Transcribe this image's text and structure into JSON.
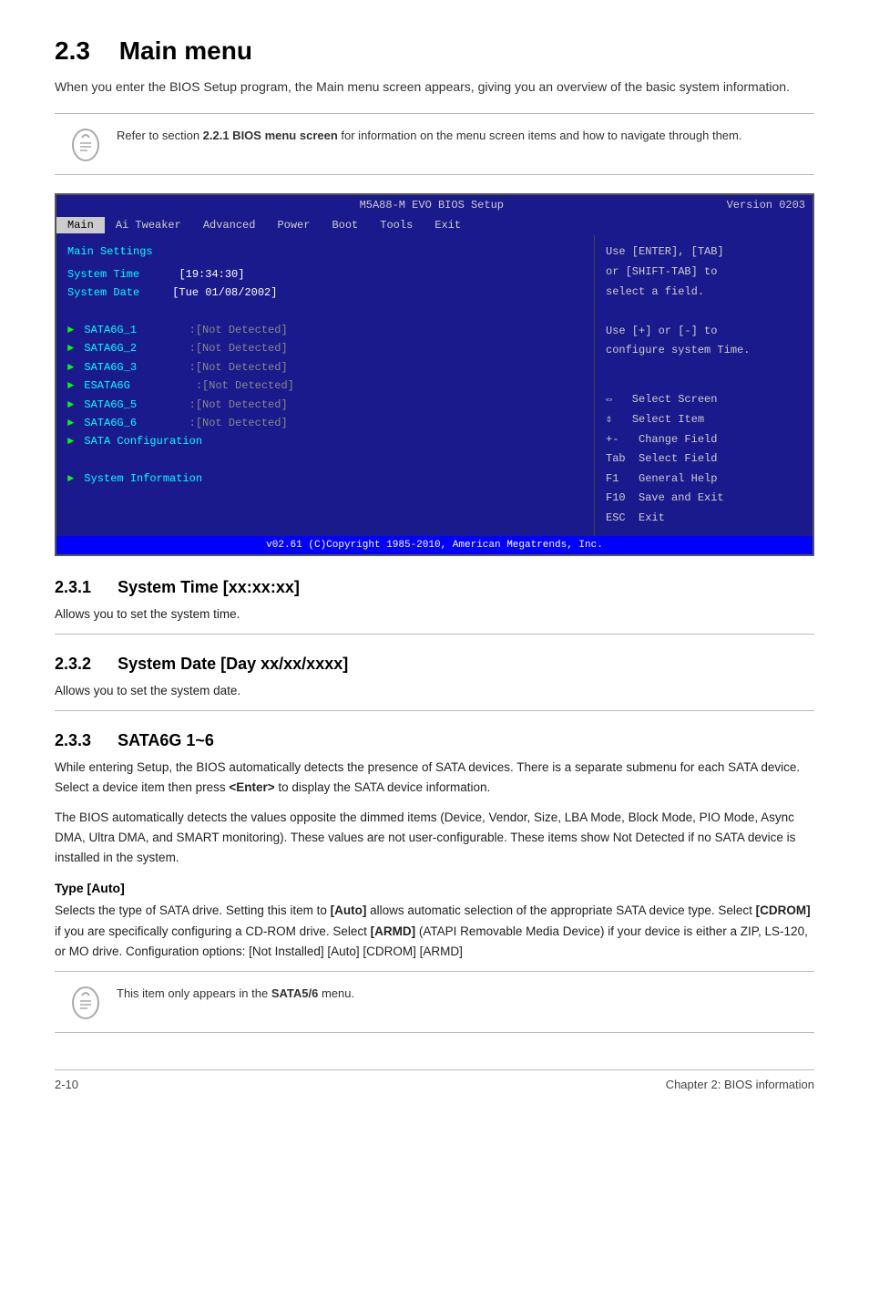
{
  "page": {
    "section_number": "2.3",
    "section_title": "Main menu",
    "intro": "When you enter the BIOS Setup program, the Main menu screen appears, giving you an overview of the basic system information.",
    "note1": {
      "text": "Refer to section ",
      "bold": "2.2.1 BIOS menu screen",
      "text2": " for information on the menu screen items and how to navigate through them."
    },
    "bios": {
      "title_center": "M5A88-M EVO BIOS Setup",
      "title_right": "Version 0203",
      "menu_items": [
        "Main",
        "Ai Tweaker",
        "Advanced",
        "Power",
        "Boot",
        "Tools",
        "Exit"
      ],
      "active_menu": "Main",
      "section_header": "Main Settings",
      "system_time_label": "System Time",
      "system_time_value": "[19:34:30]",
      "system_date_label": "System Date",
      "system_date_value": "[Tue 01/08/2002]",
      "sata_items": [
        {
          "label": "SATA6G_1",
          "value": ":[Not Detected]"
        },
        {
          "label": "SATA6G_2",
          "value": ":[Not Detected]"
        },
        {
          "label": "SATA6G_3",
          "value": ":[Not Detected]"
        },
        {
          "label": "ESATA6G",
          "value": ":[Not Detected]"
        },
        {
          "label": "SATA6G_5",
          "value": ":[Not Detected]"
        },
        {
          "label": "SATA6G_6",
          "value": ":[Not Detected]"
        }
      ],
      "sata_config_label": "SATA Configuration",
      "system_info_label": "System Information",
      "help_right": [
        "Use [ENTER], [TAB]",
        "or [SHIFT-TAB] to",
        "select a field.",
        "",
        "Use [+] or [-] to",
        "configure system Time."
      ],
      "nav_help": [
        {
          "key": "↔",
          "desc": "Select Screen"
        },
        {
          "key": "↕",
          "desc": "Select Item"
        },
        {
          "key": "+-",
          "desc": "Change Field"
        },
        {
          "key": "Tab",
          "desc": "Select Field"
        },
        {
          "key": "F1",
          "desc": "General Help"
        },
        {
          "key": "F10",
          "desc": "Save and Exit"
        },
        {
          "key": "ESC",
          "desc": "Exit"
        }
      ],
      "footer": "v02.61 (C)Copyright 1985-2010, American Megatrends, Inc."
    },
    "sub_sections": [
      {
        "number": "2.3.1",
        "title": "System Time [xx:xx:xx]",
        "body": "Allows you to set the system time."
      },
      {
        "number": "2.3.2",
        "title": "System Date [Day xx/xx/xxxx]",
        "body": "Allows you to set the system date."
      },
      {
        "number": "2.3.3",
        "title": "SATA6G 1~6",
        "body1": "While entering Setup, the BIOS automatically detects the presence of SATA devices. There is a separate submenu for each SATA device. Select a device item then press ",
        "body1_bold": "<Enter>",
        "body1_end": " to display the SATA device information.",
        "body2": "The BIOS automatically detects the values opposite the dimmed items (Device, Vendor, Size, LBA Mode, Block Mode, PIO Mode, Async DMA, Ultra DMA, and SMART monitoring). These values are not user-configurable. These items show Not Detected if no SATA device is installed in the system.",
        "sub_sub": {
          "title": "Type [Auto]",
          "body": "Selects the type of SATA drive. Setting this item to ",
          "bold1": "[Auto]",
          "body2": " allows automatic selection of the appropriate SATA device type. Select ",
          "bold2": "[CDROM]",
          "body3": " if you are specifically configuring a CD-ROM drive. Select ",
          "bold3": "[ARMD]",
          "body4": " (ATAPI Removable Media Device) if your device is either a ZIP, LS-120, or MO drive. Configuration options: [Not Installed] [Auto] [CDROM] [ARMD]"
        }
      }
    ],
    "note2": {
      "text": "This item only appears in the ",
      "bold": "SATA5/6",
      "text2": " menu."
    },
    "footer": {
      "left": "2-10",
      "right": "Chapter 2: BIOS information"
    }
  }
}
